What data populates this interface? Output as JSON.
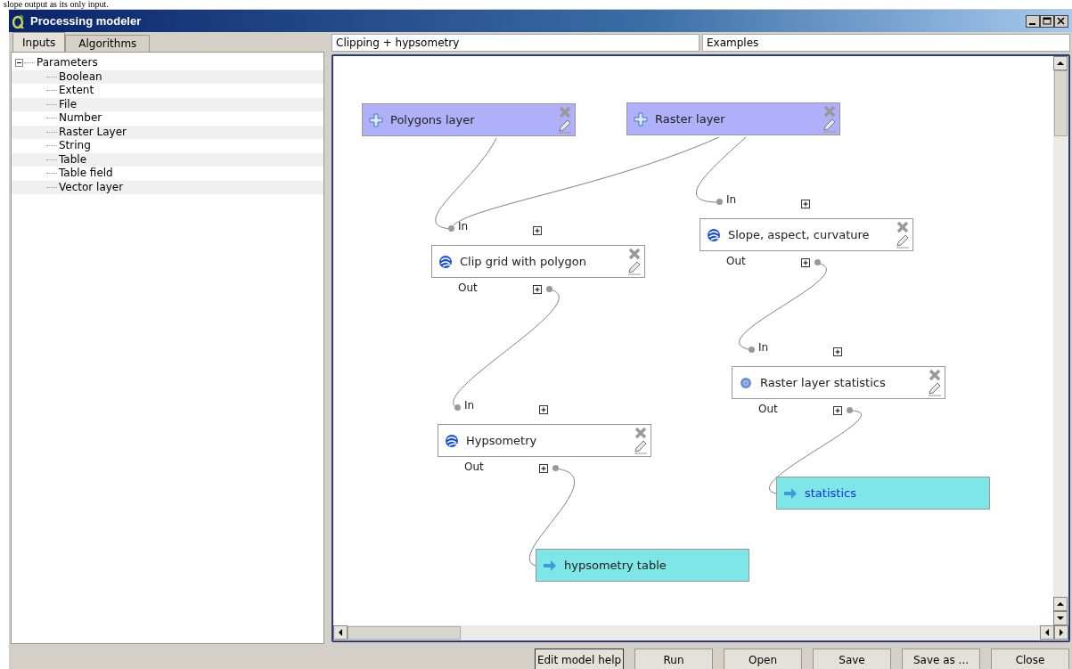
{
  "caption": "slope output as its only input.",
  "window": {
    "title": "Processing modeler"
  },
  "tabs": [
    {
      "label": "Inputs",
      "selected": true
    },
    {
      "label": "Algorithms",
      "selected": false
    }
  ],
  "tree": [
    {
      "label": "Parameters",
      "expanded": true,
      "children": [
        {
          "label": "Boolean"
        },
        {
          "label": "Extent"
        },
        {
          "label": "File"
        },
        {
          "label": "Number"
        },
        {
          "label": "Raster Layer"
        },
        {
          "label": "String"
        },
        {
          "label": "Table"
        },
        {
          "label": "Table field"
        },
        {
          "label": "Vector layer"
        }
      ]
    }
  ],
  "model_name": {
    "value": "Clipping + hypsometry"
  },
  "model_group": {
    "value": "Examples"
  },
  "nodes": [
    {
      "kind": "input",
      "label": "Polygons layer"
    },
    {
      "kind": "input",
      "label": "Raster layer"
    },
    {
      "kind": "algorithm",
      "label": "Clip grid with polygon",
      "inputs": [
        "In"
      ],
      "outputs": [
        "Out"
      ]
    },
    {
      "kind": "algorithm",
      "label": "Slope, aspect, curvature",
      "inputs": [
        "In"
      ],
      "outputs": [
        "Out"
      ]
    },
    {
      "kind": "statistics",
      "label": "Raster layer statistics",
      "inputs": [
        "In"
      ],
      "outputs": [
        "Out"
      ]
    },
    {
      "kind": "algorithm",
      "label": "Hypsometry",
      "inputs": [
        "In"
      ],
      "outputs": [
        "Out"
      ]
    },
    {
      "kind": "output",
      "label": "statistics",
      "selected": true
    },
    {
      "kind": "output",
      "label": "hypsometry table",
      "selected": false
    }
  ],
  "buttons": [
    "Edit model help",
    "Run",
    "Open",
    "Save",
    "Save as ...",
    "Close"
  ]
}
